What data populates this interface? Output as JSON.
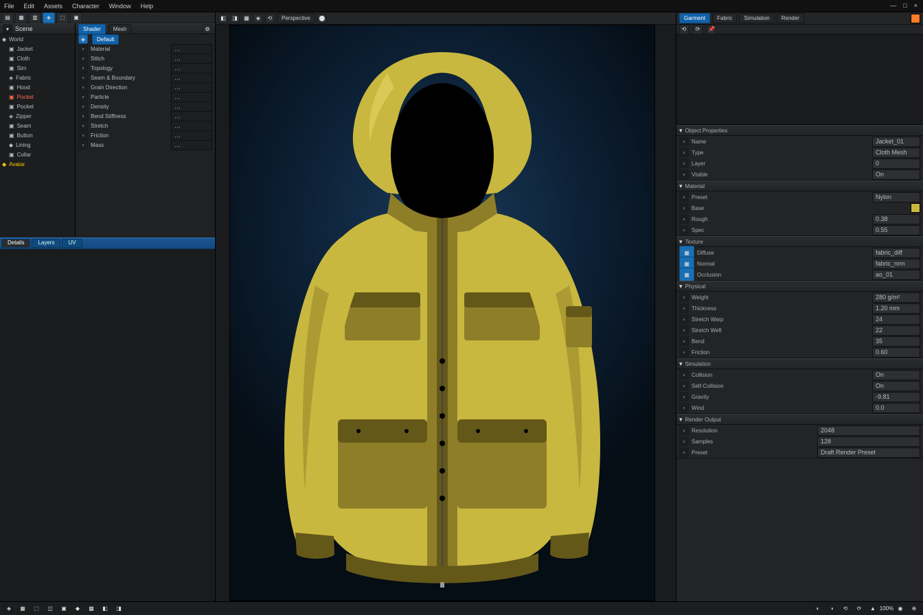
{
  "menubar": [
    "File",
    "Edit",
    "Assets",
    "Character",
    "Window",
    "Help"
  ],
  "window_controls": [
    "—",
    "□",
    "×"
  ],
  "left": {
    "toolstrip_btns": [
      "▤",
      "▦",
      "▥",
      "◈",
      "⬚",
      "▣"
    ],
    "outliner": [
      {
        "icon": "📄",
        "label": "Scene",
        "color": "#4da6ff"
      },
      {
        "icon": "◆",
        "label": "World"
      },
      {
        "icon": "▣",
        "label": "Jacket",
        "indent": 1
      },
      {
        "icon": "▣",
        "label": "Cloth",
        "indent": 1
      },
      {
        "icon": "▣",
        "label": "Sim",
        "indent": 1
      },
      {
        "icon": "◈",
        "label": "Fabric",
        "indent": 1
      },
      {
        "icon": "▣",
        "label": "Hood",
        "indent": 1
      },
      {
        "icon": "▣",
        "label": "Pocket",
        "indent": 1,
        "color": "#ff6b4a"
      },
      {
        "icon": "▣",
        "label": "Pocket",
        "indent": 1
      },
      {
        "icon": "◈",
        "label": "Zipper",
        "indent": 1
      },
      {
        "icon": "▣",
        "label": "Seam",
        "indent": 1
      },
      {
        "icon": "▣",
        "label": "Button",
        "indent": 1
      },
      {
        "icon": "◆",
        "label": "Lining",
        "indent": 1
      },
      {
        "icon": "▣",
        "label": "Collar",
        "indent": 1
      },
      {
        "icon": "◆",
        "label": "Avatar",
        "color": "#ffcc00"
      }
    ],
    "prop_header": [
      "Shader",
      "Mesh"
    ],
    "props": [
      {
        "label": "Default"
      },
      {
        "label": "Material"
      },
      {
        "label": "Stitch"
      },
      {
        "label": "Topology"
      },
      {
        "label": "Seam & Boundary",
        "muted": true
      },
      {
        "label": "Grain Direction"
      },
      {
        "label": "Particle"
      },
      {
        "label": "Density"
      },
      {
        "label": "Bend Stiffness"
      },
      {
        "label": "Stretch"
      },
      {
        "label": "Friction"
      },
      {
        "label": "Mass"
      }
    ],
    "tabs": [
      "Details",
      "Layers",
      "UV"
    ]
  },
  "center": {
    "toolbar": [
      "Perspective",
      "◫",
      "▦",
      "◈",
      "⟲",
      "⬤"
    ]
  },
  "right": {
    "top_tabs": [
      "Garment",
      "Fabric",
      "Simulation",
      "Render"
    ],
    "group_a": {
      "title": "Object Properties",
      "rows": [
        {
          "l": "Name",
          "v": "Jacket_01"
        },
        {
          "l": "Type",
          "v": "Cloth Mesh"
        },
        {
          "l": "Layer",
          "v": "0"
        },
        {
          "l": "Visible",
          "v": "On"
        }
      ]
    },
    "group_b": {
      "title": "Material",
      "rows": [
        {
          "l": "Preset",
          "v": "Nylon"
        },
        {
          "l": "Base",
          "v": "#c9b83f"
        },
        {
          "l": "Rough",
          "v": "0.38"
        },
        {
          "l": "Spec",
          "v": "0.55"
        }
      ]
    },
    "group_c": {
      "title": "Texture",
      "rows": [
        {
          "l": "Diffuse",
          "v": "fabric_diff"
        },
        {
          "l": "Normal",
          "v": "fabric_nrm"
        },
        {
          "l": "Occlusion",
          "v": "ao_01"
        }
      ]
    },
    "group_d": {
      "title": "Physical",
      "rows": [
        {
          "l": "Weight",
          "v": "280 g/m²"
        },
        {
          "l": "Thickness",
          "v": "1.20 mm"
        },
        {
          "l": "Stretch Warp",
          "v": "24"
        },
        {
          "l": "Stretch Weft",
          "v": "22"
        },
        {
          "l": "Bend",
          "v": "35"
        },
        {
          "l": "Friction",
          "v": "0.60"
        }
      ]
    },
    "group_e": {
      "title": "Simulation",
      "rows": [
        {
          "l": "Collision",
          "v": "On"
        },
        {
          "l": "Self-Collision",
          "v": "On"
        },
        {
          "l": "Gravity",
          "v": "-9.81"
        },
        {
          "l": "Wind",
          "v": "0.0"
        }
      ]
    },
    "group_f": {
      "title": "Render Output",
      "rows": [
        {
          "l": "Resolution",
          "v": "2048"
        },
        {
          "l": "Samples",
          "v": "128"
        },
        {
          "l": "Preset",
          "v": "Draft Render Preset"
        }
      ]
    }
  },
  "status": {
    "left": [
      "◈",
      "▦",
      "⬚",
      "◫",
      "▣",
      "◆",
      "▩",
      "◧",
      "◨"
    ],
    "right": [
      "◐",
      "◑",
      "⟲",
      "⟳",
      "▲",
      "100%",
      "◉",
      "⊕"
    ]
  },
  "colors": {
    "accent": "#c9b83f",
    "bg_deep": "#0d2238"
  }
}
